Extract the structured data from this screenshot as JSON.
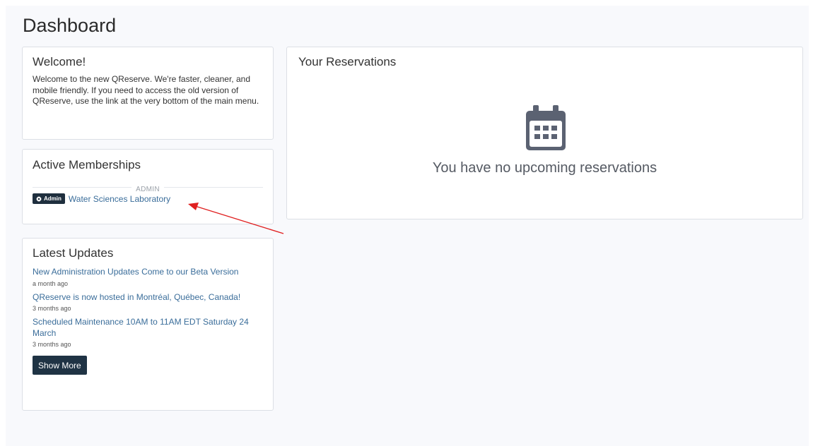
{
  "page": {
    "title": "Dashboard"
  },
  "welcome": {
    "title": "Welcome!",
    "body": "Welcome to the new QReserve. We're faster, cleaner, and mobile friendly. If you need to access the old version of QReserve, use the link at the very bottom of the main menu."
  },
  "memberships": {
    "title": "Active Memberships",
    "section_label": "ADMIN",
    "items": [
      {
        "badge": "Admin",
        "badge_icon": "gear-icon",
        "name": "Water Sciences Laboratory"
      }
    ]
  },
  "updates": {
    "title": "Latest Updates",
    "items": [
      {
        "title": "New Administration Updates Come to our Beta Version",
        "time": "a month ago"
      },
      {
        "title": "QReserve is now hosted in Montréal, Québec, Canada!",
        "time": "3 months ago"
      },
      {
        "title": "Scheduled Maintenance 10AM to 11AM EDT Saturday 24 March",
        "time": "3 months ago"
      }
    ],
    "show_more_label": "Show More"
  },
  "reservations": {
    "title": "Your Reservations",
    "empty_icon": "calendar-icon",
    "empty_message": "You have no upcoming reservations"
  },
  "colors": {
    "link": "#3a6d9a",
    "dark_button": "#1f3344",
    "badge": "#1f2f3e",
    "annotation_arrow": "#e02020",
    "page_background": "#f8f9fc"
  }
}
